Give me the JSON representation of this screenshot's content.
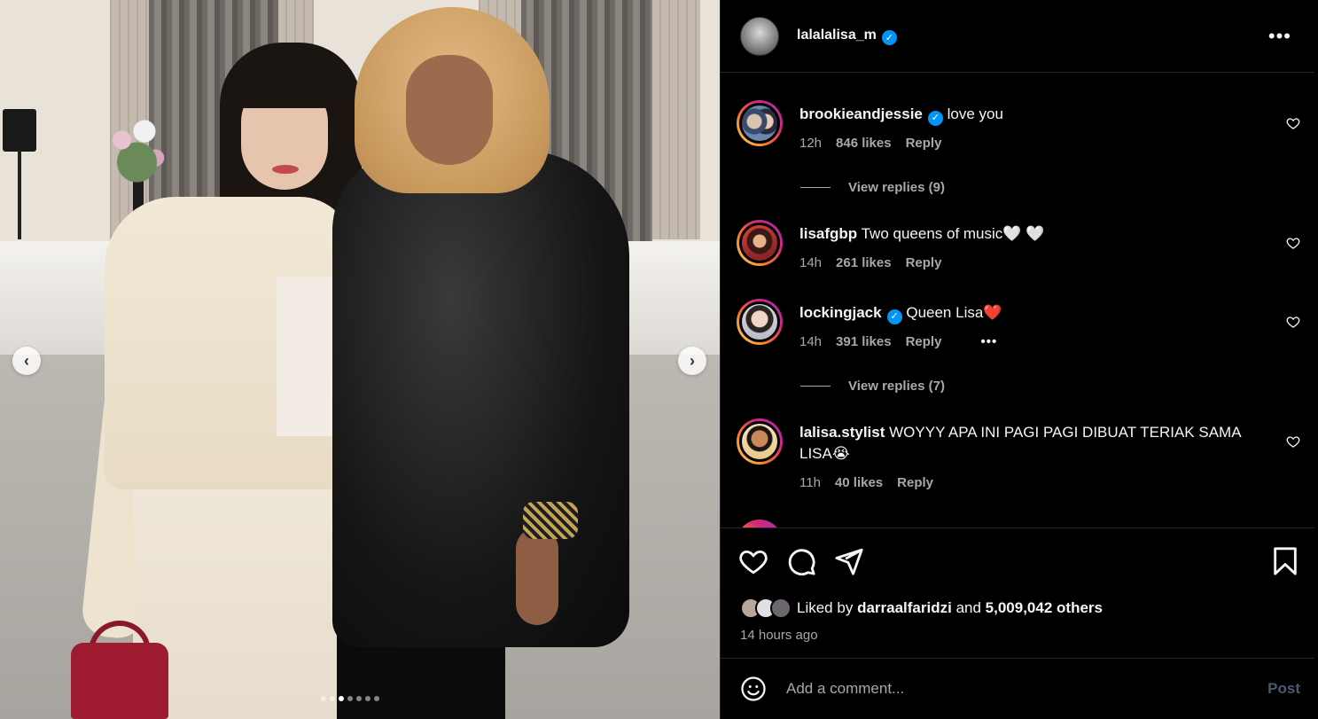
{
  "post": {
    "username": "lalalalisa_m",
    "verified": true,
    "photo_count": 7,
    "photo_index": 3
  },
  "comments": [
    {
      "user": "brookieandjessie",
      "verified": true,
      "text": "love you",
      "time": "12h",
      "likes": "846 likes",
      "reply": "Reply",
      "view_replies": "View replies (9)"
    },
    {
      "user": "lisafgbp",
      "verified": false,
      "text": "Two queens of music🤍 🤍",
      "time": "14h",
      "likes": "261 likes",
      "reply": "Reply"
    },
    {
      "user": "lockingjack",
      "verified": true,
      "text": "Queen Lisa❤️",
      "time": "14h",
      "likes": "391 likes",
      "reply": "Reply",
      "more": "•••",
      "view_replies": "View replies (7)"
    },
    {
      "user": "lalisa.stylist",
      "verified": false,
      "text": "WOYYY APA INI PAGI PAGI DIBUAT TERIAK SAMA LISA😭",
      "time": "11h",
      "likes": "40 likes",
      "reply": "Reply"
    }
  ],
  "likes": {
    "prefix": "Liked by",
    "user": "darraalfaridzi",
    "joiner": "and",
    "others": "5,009,042 others"
  },
  "timestamp": "14 hours ago",
  "comment_box": {
    "placeholder": "Add a comment...",
    "post_label": "Post"
  },
  "icons": {
    "more": "more-options-icon",
    "like": "heart-icon",
    "comment": "comment-icon",
    "share": "send-icon",
    "save": "bookmark-icon",
    "emoji": "emoji-icon",
    "prev": "chevron-left-icon",
    "next": "chevron-right-icon"
  },
  "colors": {
    "verified_blue": "#0095f6",
    "muted_text": "#a8a8a8",
    "post_disabled": "#4a5a6e"
  }
}
